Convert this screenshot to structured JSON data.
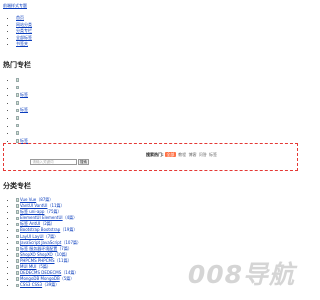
{
  "header": {
    "breadcrumb": "前端样式专题"
  },
  "top_nav": [
    "首页",
    "网站分类",
    "分类专栏",
    "全部标签",
    "书签夹"
  ],
  "hot_section": {
    "title": "热门专栏",
    "items": [
      "",
      "",
      "标签",
      "",
      "标签",
      "",
      "",
      "",
      "标签"
    ]
  },
  "search": {
    "hot_label": "搜索热门:",
    "keywords": [
      "全部",
      "教程",
      "博客",
      "问答",
      "标签"
    ],
    "input_placeholder": "请输入关键词",
    "button_label": "搜索"
  },
  "category_section": {
    "title": "分类专栏",
    "items": [
      {
        "label": "Vue Vue",
        "count": "（87篇）"
      },
      {
        "label": "VantUI VantUI",
        "count": "（11篇）"
      },
      {
        "label": "标签 uni-app",
        "count": "（75篇）"
      },
      {
        "label": "ElementUI ElementUI",
        "count": "（4篇）"
      },
      {
        "label": "标签 AntUI",
        "count": "（2篇）"
      },
      {
        "label": "Bootstrap Bootstrap",
        "count": "（19篇）"
      },
      {
        "label": "LayUI LayUI",
        "count": "（7篇）"
      },
      {
        "label": "JavaScript JavaScript",
        "count": "（107篇）"
      },
      {
        "label": "标签 服务器环境配置",
        "count": "（7篇）"
      },
      {
        "label": "ShopXO ShopXO",
        "count": "（10篇）"
      },
      {
        "label": "PHPCMS PHPCMS",
        "count": "（11篇）"
      },
      {
        "label": "MUI MUI",
        "count": "（5篇）"
      },
      {
        "label": "DEDECMS DEDECMS",
        "count": "（14篇）"
      },
      {
        "label": "MongoDB MongoDB",
        "count": "（5篇）"
      },
      {
        "label": "CSS3 CSS3",
        "count": "（39篇）"
      }
    ]
  },
  "watermark": {
    "text": "008导航"
  }
}
